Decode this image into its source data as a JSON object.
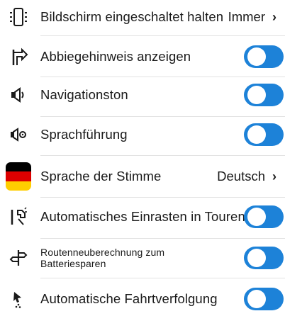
{
  "settings": {
    "rows": [
      {
        "label": "Bildschirm eingeschaltet halten",
        "value": "Immer",
        "icon": "phone-screen-icon"
      },
      {
        "label": "Abbiegehinweis anzeigen",
        "toggle": true,
        "icon": "turn-sign-icon"
      },
      {
        "label": "Navigationston",
        "toggle": true,
        "icon": "speaker-icon"
      },
      {
        "label": "Sprachführung",
        "toggle": true,
        "icon": "voice-speaker-icon"
      },
      {
        "label": "Sprache der Stimme",
        "value": "Deutsch",
        "icon": "german-flag-icon"
      },
      {
        "label": "Automatisches Einrasten in Touren",
        "toggle": true,
        "icon": "snap-route-icon"
      },
      {
        "label": "Routenneuberechnung zum Batteriesparen",
        "toggle": true,
        "icon": "route-recalc-icon"
      },
      {
        "label": "Automatische Fahrtverfolgung",
        "toggle": true,
        "icon": "auto-tracking-icon"
      }
    ],
    "chevron": "›"
  },
  "colors": {
    "toggle_on": "#1d82d8",
    "divider": "#e2e2e2",
    "flag": [
      "#000000",
      "#dd0000",
      "#ffce00"
    ]
  }
}
